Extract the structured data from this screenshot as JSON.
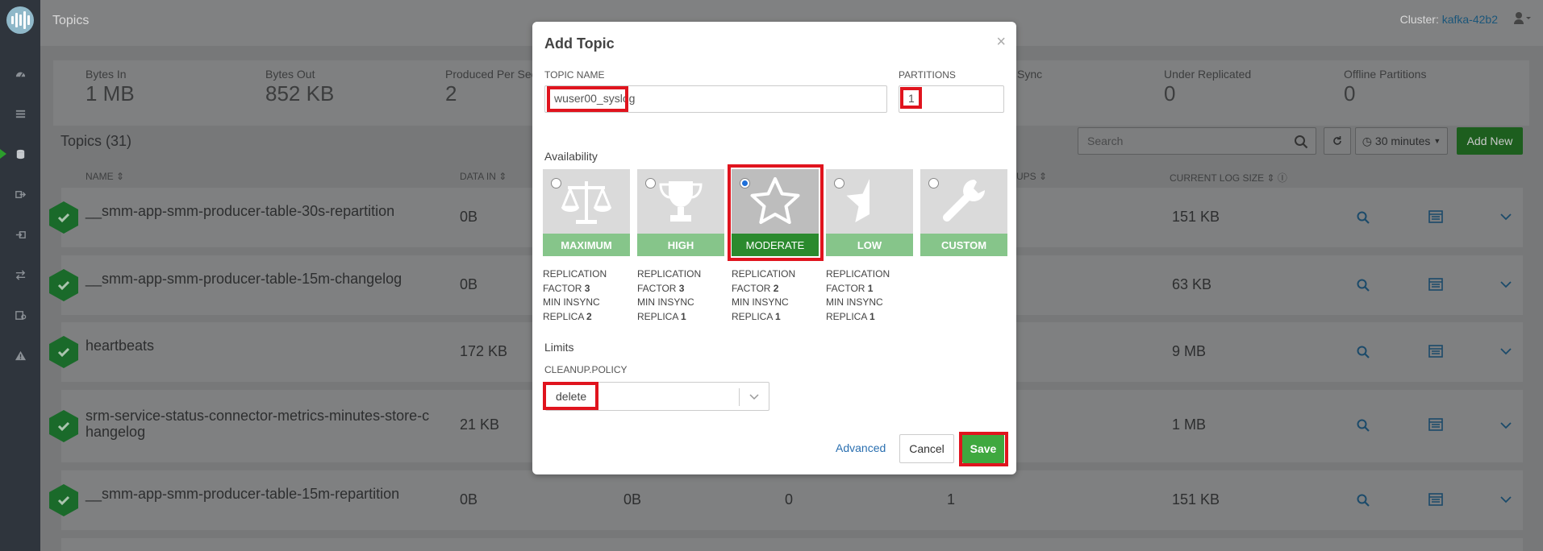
{
  "header": {
    "title": "Topics",
    "cluster_label": "Cluster:",
    "cluster_name": "kafka-42b2"
  },
  "stats": [
    {
      "label": "Bytes In",
      "value": "1 MB"
    },
    {
      "label": "Bytes Out",
      "value": "852 KB"
    },
    {
      "label": "Produced Per Sec",
      "value": "2"
    },
    {
      "label": "Sync",
      "value": ""
    },
    {
      "label": "Under Replicated",
      "value": "0"
    },
    {
      "label": "Offline Partitions",
      "value": "0"
    }
  ],
  "topics": {
    "title": "Topics (31)",
    "search_placeholder": "Search",
    "time_range": "30 minutes",
    "add_new": "Add New"
  },
  "columns": {
    "name": "NAME",
    "data_in": "DATA IN",
    "groups": "UPS",
    "log_size": "CURRENT LOG SIZE"
  },
  "rows": [
    {
      "name": "__smm-app-smm-producer-table-30s-repartition",
      "data_in": "0B",
      "log_size": "151 KB"
    },
    {
      "name": "__smm-app-smm-producer-table-15m-changelog",
      "data_in": "0B",
      "log_size": "63 KB"
    },
    {
      "name": "heartbeats",
      "data_in": "172 KB",
      "log_size": "9 MB"
    },
    {
      "name": "srm-service-status-connector-metrics-minutes-store-c hangelog",
      "data_in": "21 KB",
      "log_size": "1 MB"
    },
    {
      "name": "__smm-app-smm-producer-table-15m-repartition",
      "data_in": "0B",
      "data_out": "0B",
      "messages": "0",
      "partitions": "1",
      "log_size": "151 KB"
    }
  ],
  "modal": {
    "title": "Add Topic",
    "close": "×",
    "topic_name_label": "TOPIC NAME",
    "topic_name_value": "wuser00_syslog",
    "partitions_label": "PARTITIONS",
    "partitions_value": "1",
    "availability_label": "Availability",
    "options": [
      {
        "label": "MAXIMUM",
        "line1": "REPLICATION",
        "line2": "FACTOR",
        "rf": "3",
        "line3": "MIN INSYNC",
        "line4": "REPLICA",
        "mi": "2",
        "selected": false
      },
      {
        "label": "HIGH",
        "line1": "REPLICATION",
        "line2": "FACTOR",
        "rf": "3",
        "line3": "MIN INSYNC",
        "line4": "REPLICA",
        "mi": "1",
        "selected": false
      },
      {
        "label": "MODERATE",
        "line1": "REPLICATION",
        "line2": "FACTOR",
        "rf": "2",
        "line3": "MIN INSYNC",
        "line4": "REPLICA",
        "mi": "1",
        "selected": true
      },
      {
        "label": "LOW",
        "line1": "REPLICATION",
        "line2": "FACTOR",
        "rf": "1",
        "line3": "MIN INSYNC",
        "line4": "REPLICA",
        "mi": "1",
        "selected": false
      },
      {
        "label": "CUSTOM",
        "selected": false
      }
    ],
    "limits_label": "Limits",
    "cleanup_label": "CLEANUP.POLICY",
    "cleanup_value": "delete",
    "advanced": "Advanced",
    "cancel": "Cancel",
    "save": "Save"
  },
  "colors": {
    "accent": "#3fa83f",
    "link": "#2a6fb0",
    "highlight": "#e0141e",
    "sidebar": "#2f353d"
  }
}
